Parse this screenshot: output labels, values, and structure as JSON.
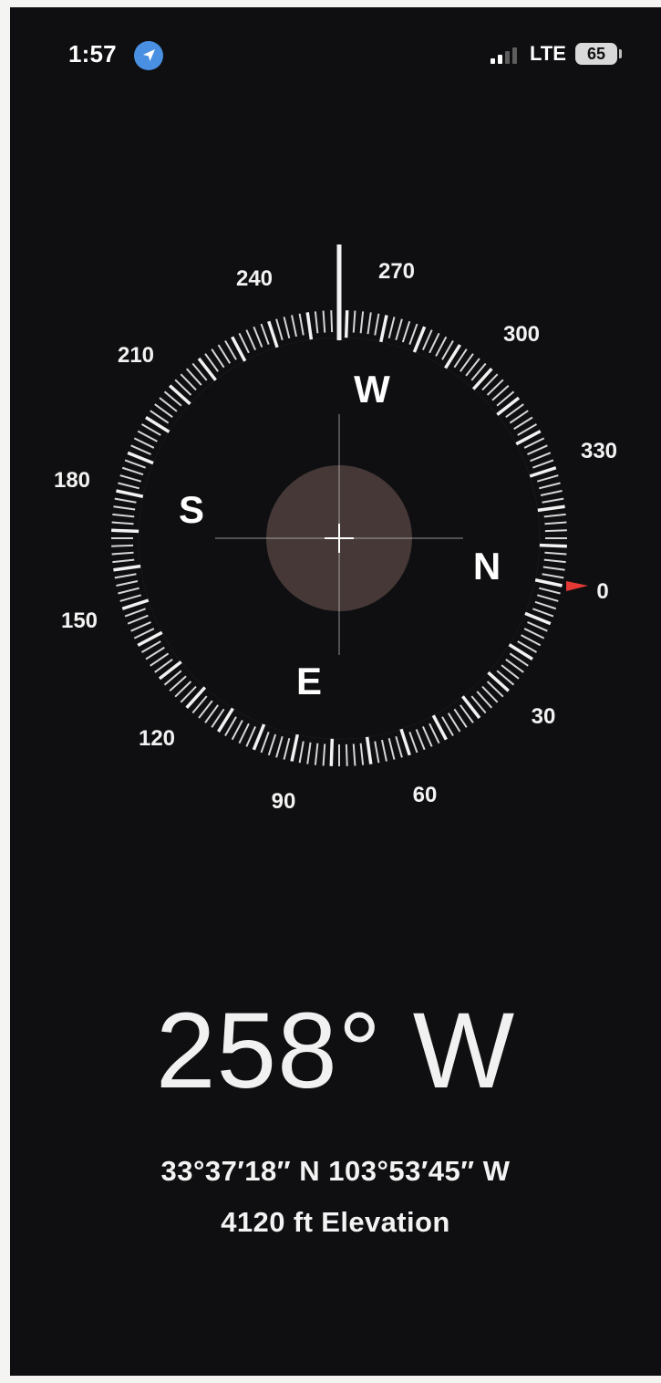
{
  "status_bar": {
    "time": "1:57",
    "network": "LTE",
    "battery": "65",
    "location_icon": "location-arrow-icon",
    "signal_icon": "signal-bars-icon"
  },
  "compass": {
    "heading_degrees": 258,
    "reference_direction_degrees": 0,
    "degree_labels": [
      "0",
      "30",
      "60",
      "90",
      "120",
      "150",
      "180",
      "210",
      "240",
      "270",
      "300",
      "330"
    ],
    "cardinals": [
      "N",
      "E",
      "S",
      "W"
    ],
    "colors": {
      "background": "#0f0f11",
      "ticks": "#f2f2f2",
      "reference_marker": "#e53935",
      "level_disk": "#4a3c3b"
    }
  },
  "readout": {
    "bearing": "258° W",
    "coordinates": "33°37′18″ N  103°53′45″ W",
    "elevation": "4120 ft Elevation"
  }
}
